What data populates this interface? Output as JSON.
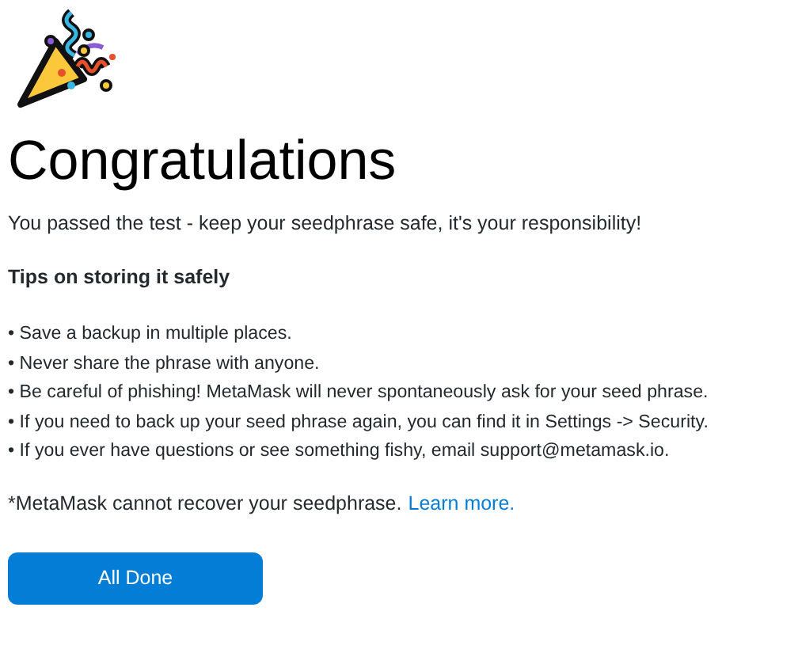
{
  "title": "Congratulations",
  "intro": "You passed the test - keep your seedphrase safe, it's your responsibility!",
  "tips_heading": "Tips on storing it safely",
  "tips": [
    "• Save a backup in multiple places.",
    "• Never share the phrase with anyone.",
    "• Be careful of phishing! MetaMask will never spontaneously ask for your seed phrase.",
    "• If you need to back up your seed phrase again, you can find it in Settings -> Security.",
    "• If you ever have questions or see something fishy, email support@metamask.io."
  ],
  "footnote": {
    "text": "*MetaMask cannot recover your seedphrase.",
    "link": "Learn more."
  },
  "button": "All Done"
}
